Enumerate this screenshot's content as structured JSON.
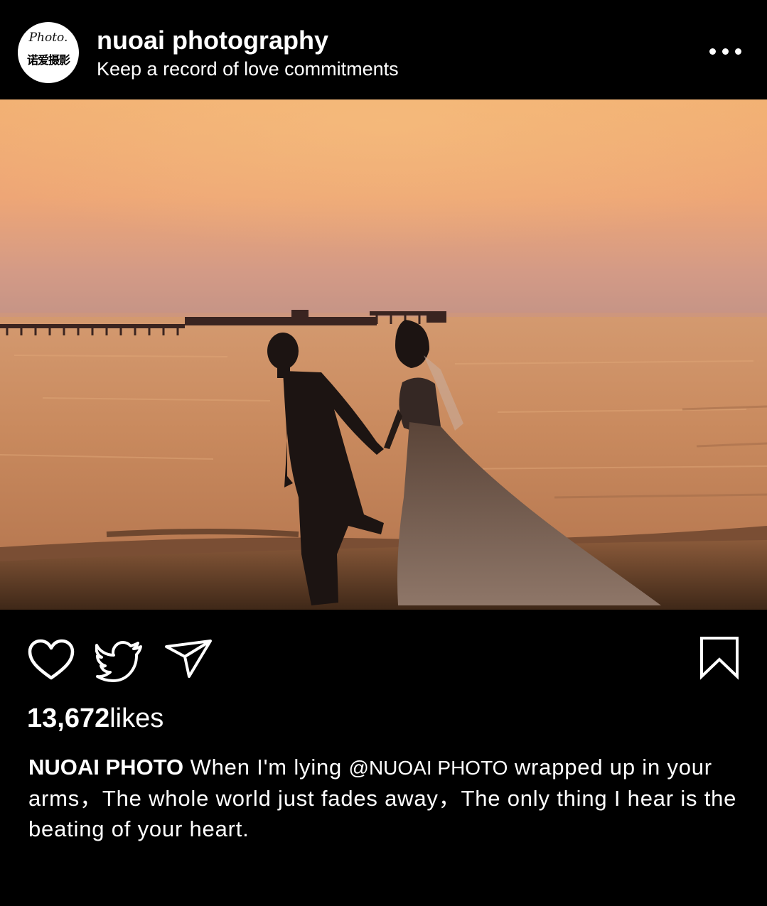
{
  "post": {
    "account": {
      "name": "nuoai photography",
      "subtitle": "Keep a record of love commitments",
      "avatar": {
        "script_text": "Photo.",
        "cn_text": "诺爱摄影"
      },
      "more_icon": "more-horizontal-icon"
    },
    "photo": {
      "alt": "Silhouette of bride and groom walking on beach at sunset with pier in background"
    },
    "actions": {
      "like_icon": "heart-icon",
      "share_icon": "twitter-bird-icon",
      "send_icon": "paper-plane-icon",
      "save_icon": "bookmark-icon"
    },
    "likes": {
      "count": "13,672",
      "label": "likes"
    },
    "caption": {
      "author": "NUOAI PHOTO",
      "text_before": " When I'm lying ",
      "mention": "@NUOAI PHOTO",
      "text_after": " wrapped up in your arms，The whole world just fades away，The only thing I hear is the beating of your heart."
    }
  },
  "colors": {
    "background": "#000000",
    "text": "#ffffff",
    "sky_top": "#f0ad72",
    "sea": "#c98a5e"
  }
}
